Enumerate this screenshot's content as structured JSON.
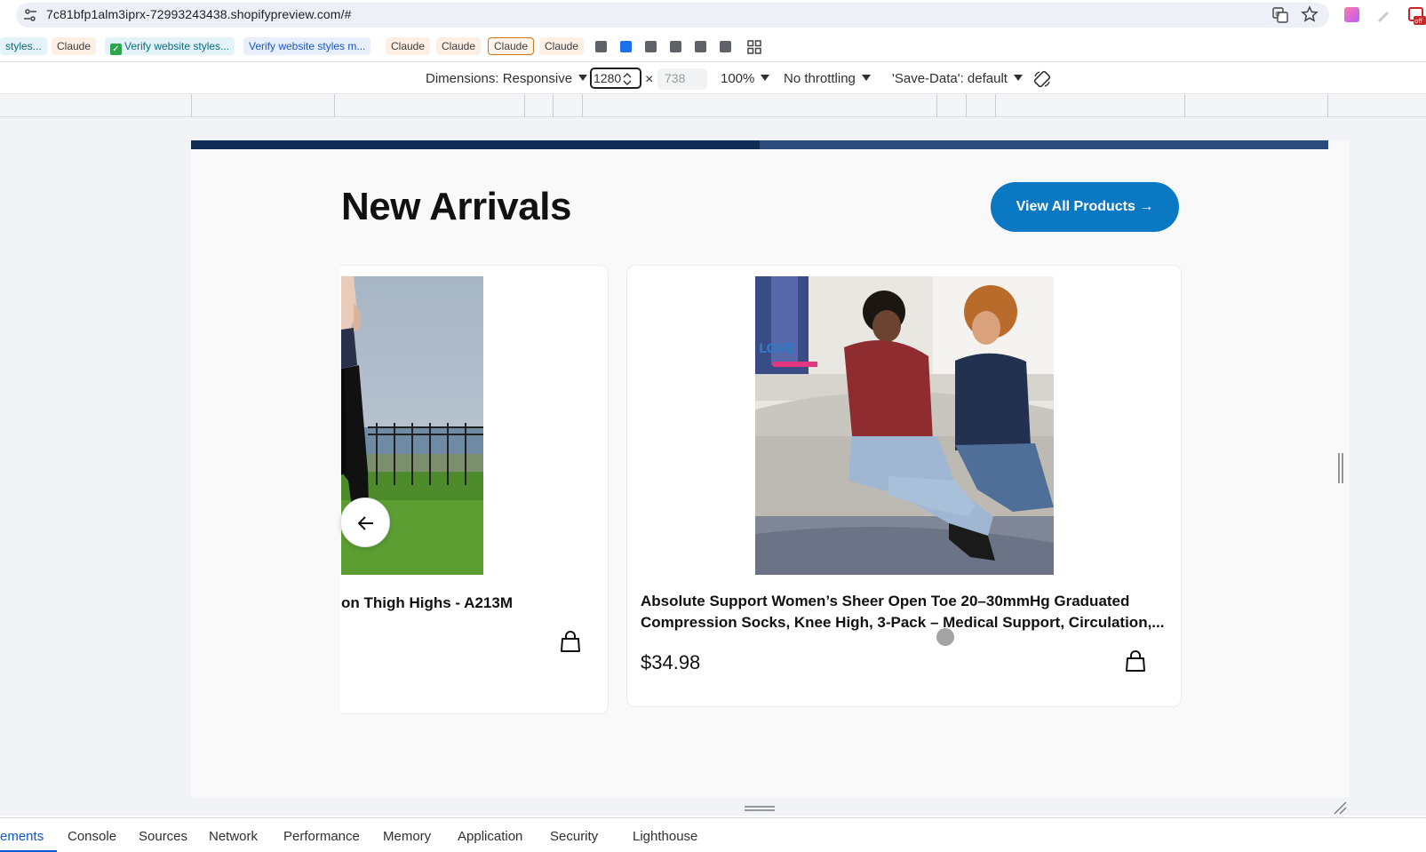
{
  "browser": {
    "url": "7c81bfp1alm3iprx-72993243438.shopifypreview.com/#",
    "icons": [
      "tune-icon",
      "translate-icon",
      "star-icon",
      "extension-icon"
    ]
  },
  "bookmarks": [
    {
      "label": "styles...",
      "style": "teal"
    },
    {
      "label": "Claude",
      "style": "orange"
    },
    {
      "label": "Verify website styles...",
      "style": "teal-check"
    },
    {
      "label": "Verify website styles m...",
      "style": "blue"
    },
    {
      "label": "Claude",
      "style": "orange"
    },
    {
      "label": "Claude",
      "style": "orange"
    },
    {
      "label": "Claude",
      "style": "orange-outline"
    },
    {
      "label": "Claude",
      "style": "orange"
    }
  ],
  "device_toolbar": {
    "dimensions": "Dimensions: Responsive",
    "width": "1280",
    "height": "738",
    "zoom": "100%",
    "throttling": "No throttling",
    "save_data": "'Save-Data': default"
  },
  "page": {
    "heading": "New Arrivals",
    "view_all": "View All Products →",
    "products": [
      {
        "title": "on Thigh Highs - A213M",
        "price": ""
      },
      {
        "title_line1": "Absolute Support Women’s Sheer Open Toe 20–30mmHg Graduated",
        "title_line2": "Compression Socks, Knee High, 3-Pack – Medical Support, Circulation,...",
        "price": "$34.98"
      }
    ]
  },
  "devtools_tabs": [
    "ements",
    "Console",
    "Sources",
    "Network",
    "Performance",
    "Memory",
    "Application",
    "Security",
    "Lighthouse"
  ],
  "colors": {
    "accent_button": "#0a78c2",
    "stripe_dark": "#0f2c55",
    "devtools_active": "#0b57d0"
  }
}
